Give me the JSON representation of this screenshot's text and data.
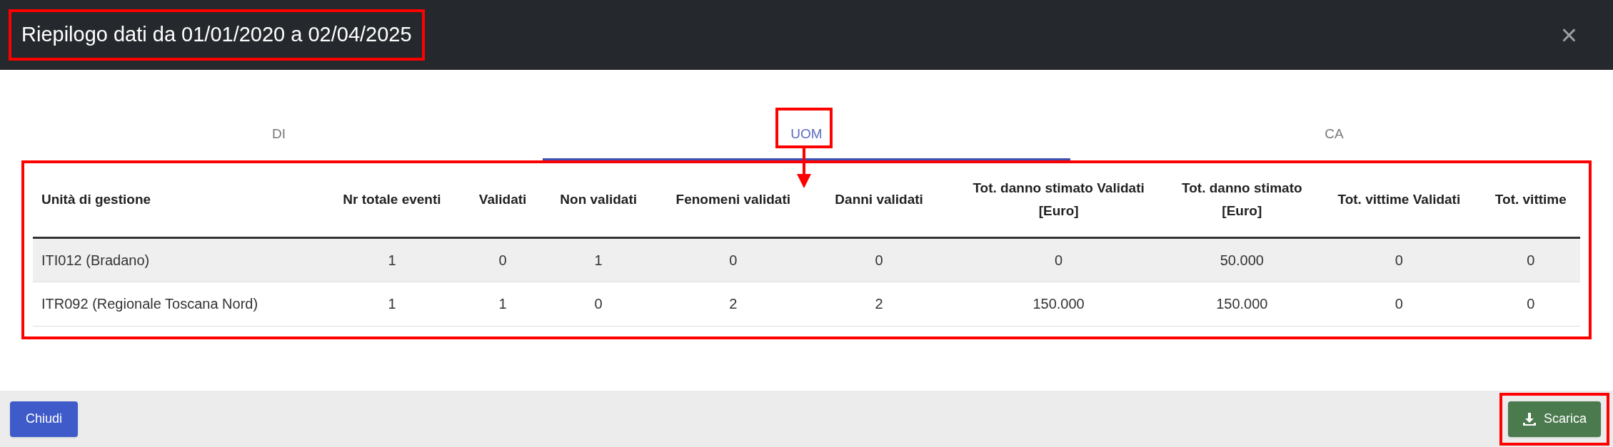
{
  "dialog": {
    "title": "Riepilogo dati da 01/01/2020 a 02/04/2025",
    "title_highlighted": true,
    "close": "×"
  },
  "tabs": [
    {
      "label": "DI",
      "selected": false,
      "highlighted": false,
      "arrow": false
    },
    {
      "label": "UOM",
      "selected": true,
      "highlighted": true,
      "arrow": true
    },
    {
      "label": "CA",
      "selected": false,
      "highlighted": false,
      "arrow": false
    }
  ],
  "table": {
    "highlighted": true,
    "columns": [
      "Unità di gestione",
      "Nr totale eventi",
      "Validati",
      "Non validati",
      "Fenomeni validati",
      "Danni validati",
      "Tot. danno stimato Validati [Euro]",
      "Tot. danno stimato [Euro]",
      "Tot. vittime Validati",
      "Tot. vittime"
    ],
    "rows": [
      [
        "ITI012 (Bradano)",
        "1",
        "0",
        "1",
        "0",
        "0",
        "0",
        "50.000",
        "0",
        "0"
      ],
      [
        "ITR092 (Regionale Toscana Nord)",
        "1",
        "1",
        "0",
        "2",
        "2",
        "150.000",
        "150.000",
        "0",
        "0"
      ]
    ]
  },
  "footer": {
    "buttons": [
      {
        "label": "Chiudi",
        "kind": "close",
        "highlighted": false
      },
      {
        "label": "Scarica",
        "kind": "download",
        "highlighted": true
      }
    ]
  }
}
